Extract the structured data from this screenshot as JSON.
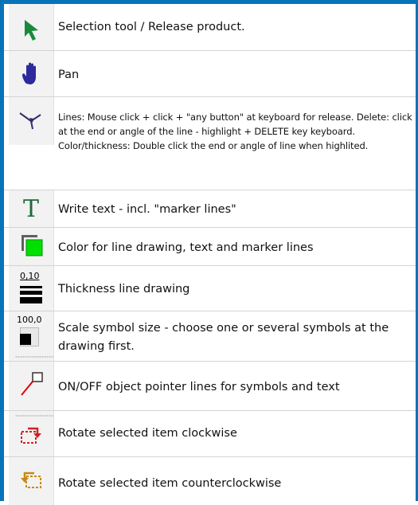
{
  "tools": [
    {
      "icon": "cursor-arrow-icon",
      "label": "Selection tool / Release product."
    },
    {
      "icon": "hand-pan-icon",
      "label": "Pan"
    },
    {
      "icon": "line-draw-icon",
      "label": "Lines: Mouse click + click + \"any button\" at keyboard for release. Delete: click at the end or angle of the line - highlight + DELETE key keyboard. Color/thickness: Double click the end or angle of line when highlited."
    },
    {
      "icon": "text-t-icon",
      "label": "Write text - incl. \"marker lines\""
    },
    {
      "icon": "color-swatch-icon",
      "label": "Color for line drawing, text and marker lines"
    },
    {
      "icon": "line-thickness-icon",
      "icon_value": "0,10",
      "label": "Thickness  line drawing"
    },
    {
      "icon": "scale-symbol-icon",
      "icon_value": "100,0",
      "label": "Scale symbol size - choose one or several symbols at the drawing first."
    },
    {
      "icon": "pointer-line-icon",
      "label": "ON/OFF object pointer lines for symbols and text"
    },
    {
      "icon": "rotate-clockwise-icon",
      "label": "Rotate selected item clockwise"
    },
    {
      "icon": "rotate-counterclockwise-icon",
      "label": "Rotate selected item counterclockwise"
    }
  ],
  "colors": {
    "frame": "#0a73b8",
    "cursor": "#1a8a3a",
    "hand": "#2c2a9c",
    "line_tool": "#3a2a6c",
    "text_t": "#1f6b3a",
    "swatch": "#00e000",
    "pointer": "#e00000",
    "rotate_cw": "#d32020",
    "rotate_ccw": "#c68a10"
  }
}
